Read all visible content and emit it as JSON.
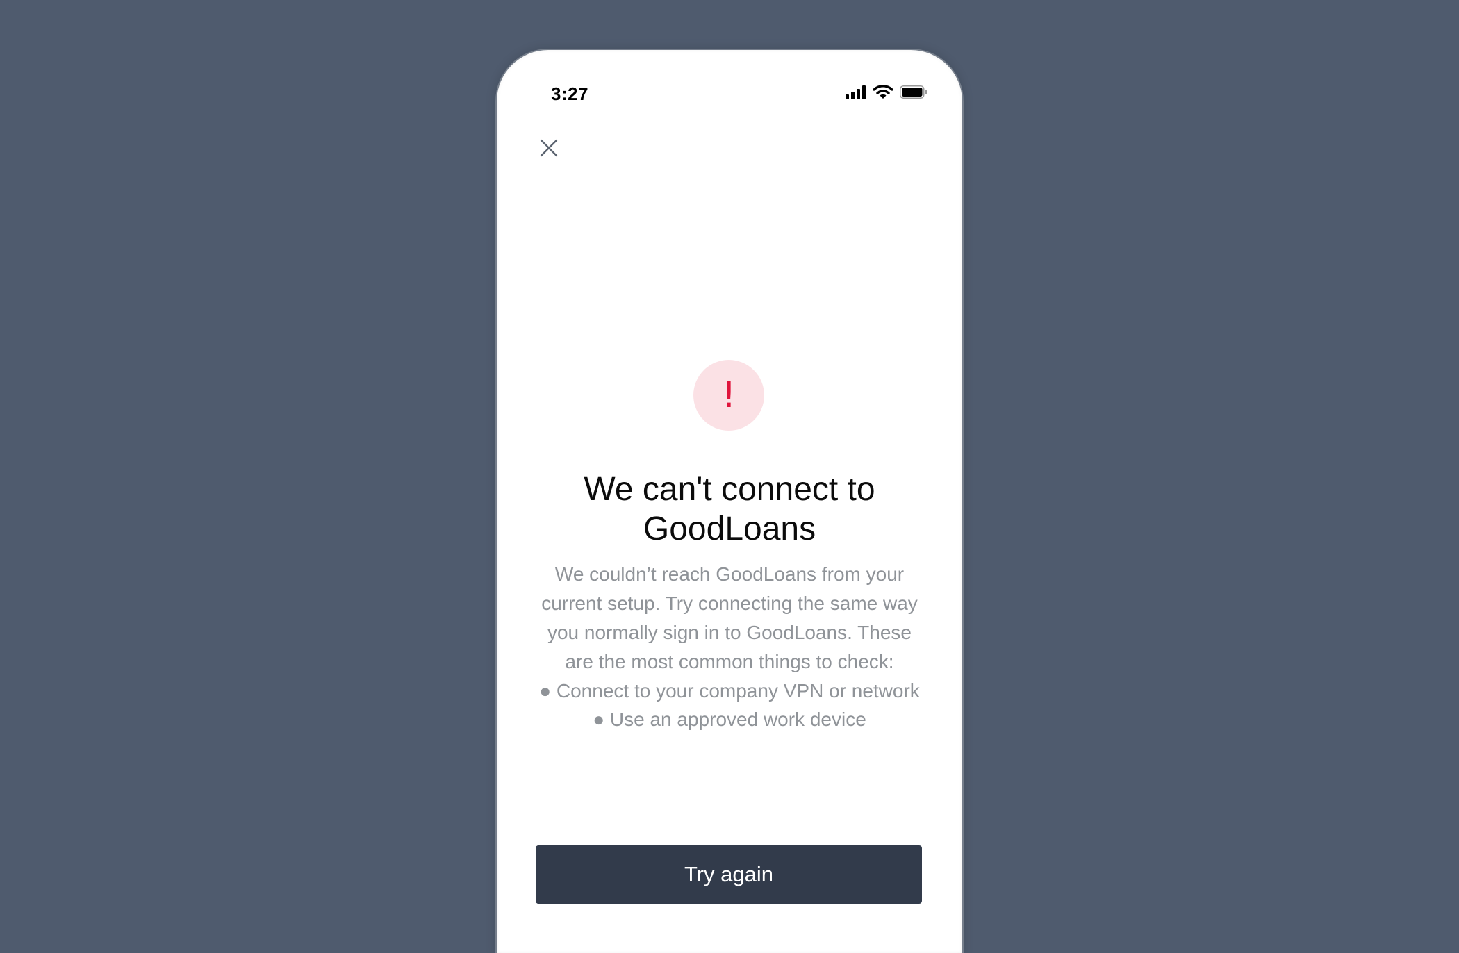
{
  "status_bar": {
    "time": "3:27",
    "signal_icon": "cellular-signal-icon",
    "wifi_icon": "wifi-icon",
    "battery_icon": "battery-icon"
  },
  "header": {
    "close_icon": "close-icon"
  },
  "alert": {
    "icon": "exclamation-icon",
    "symbol": "!",
    "icon_color": "#e0143c",
    "icon_bg": "#fbe1e5"
  },
  "message": {
    "title": "We can't connect to GoodLoans",
    "body": "We couldn’t reach GoodLoans from your current setup. Try connecting the same way you normally sign in to GoodLoans. These are the most common things to check:",
    "bullets": [
      "● Connect to your company VPN or network",
      "● Use an approved work device"
    ]
  },
  "actions": {
    "try_again_label": "Try again",
    "button_color": "#323b4b"
  }
}
